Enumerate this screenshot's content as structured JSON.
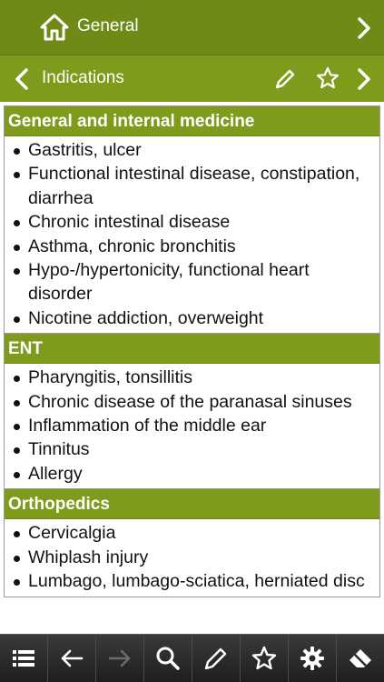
{
  "topbar": {
    "title": "General",
    "home_icon": "home-icon",
    "forward_icon": "chevron-right-icon"
  },
  "subbar": {
    "title": "Indications",
    "back_icon": "chevron-left-icon",
    "edit_icon": "pencil-icon",
    "favorite_icon": "star-icon",
    "forward_icon": "chevron-right-icon"
  },
  "sections": [
    {
      "heading": "General and internal medicine",
      "items": [
        "Gastritis, ulcer",
        "Functional intestinal disease, constipation, diarrhea",
        "Chronic intestinal disease",
        "Asthma, chronic bronchitis",
        "Hypo-/hypertonicity, functional heart disorder",
        "Nicotine addiction, overweight"
      ]
    },
    {
      "heading": "ENT",
      "items": [
        "Pharyngitis, tonsillitis",
        "Chronic disease of the paranasal sinuses",
        "Inflammation of the middle ear",
        "Tinnitus",
        "Allergy"
      ]
    },
    {
      "heading": "Orthopedics",
      "items": [
        "Cervicalgia",
        "Whiplash injury",
        "Lumbago, lumbago-sciatica, herniated disc"
      ]
    }
  ],
  "toolbar": {
    "icons": [
      "list-icon",
      "arrow-left-icon",
      "arrow-right-icon",
      "search-icon",
      "pencil-icon",
      "star-icon",
      "gear-icon",
      "eraser-icon"
    ]
  },
  "colors": {
    "bar_dark": "#6f8a16",
    "bar": "#7e9b1b",
    "toolbar": "#2a2a2a"
  }
}
